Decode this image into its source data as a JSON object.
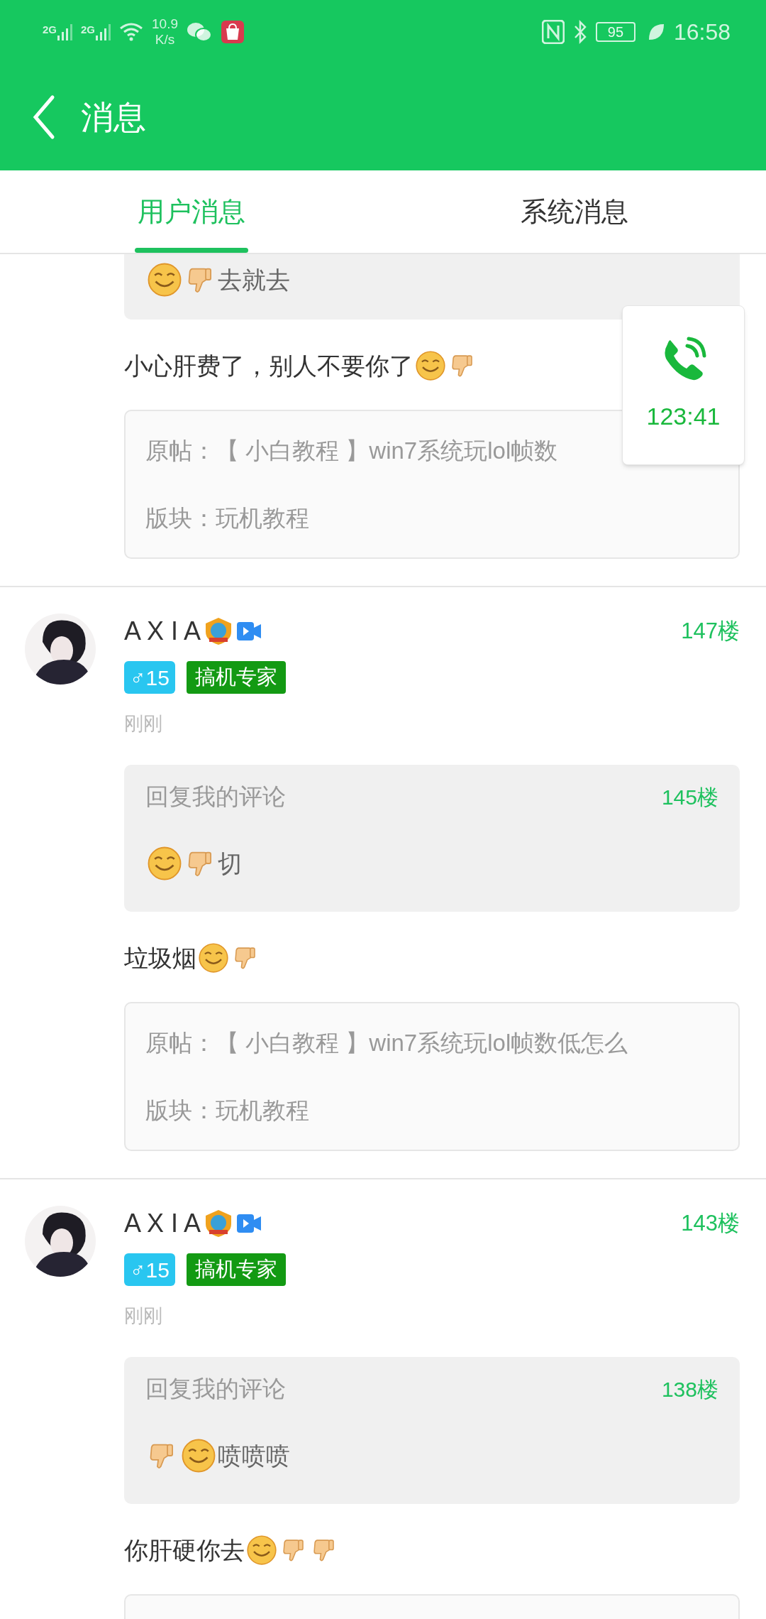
{
  "status_bar": {
    "networks": [
      "2G",
      "2G"
    ],
    "speed": "10.9",
    "speed_unit": "K/s",
    "battery": "95",
    "time": "16:58"
  },
  "header": {
    "title": "消息"
  },
  "tabs": [
    {
      "label": "用户消息",
      "selected": true
    },
    {
      "label": "系统消息",
      "selected": false
    }
  ],
  "messages": [
    {
      "reply": {
        "content": [
          {
            "kind": "smile"
          },
          {
            "kind": "thumbs_down"
          },
          {
            "kind": "text",
            "text": "去就去"
          }
        ]
      },
      "comment": [
        {
          "kind": "text",
          "text": "小心肝费了，别人不要你了"
        },
        {
          "kind": "smile"
        },
        {
          "kind": "thumbs_down"
        }
      ],
      "post": {
        "title": "原帖：【 小白教程 】win7系统玩lol帧数",
        "board": "版块：玩机教程"
      }
    },
    {
      "user": {
        "name": "A X I A",
        "gender": "♂",
        "level": "15",
        "title": "搞机专家"
      },
      "floor": "147楼",
      "time": "刚刚",
      "reply": {
        "label": "回复我的评论",
        "floor": "145楼",
        "content": [
          {
            "kind": "smile"
          },
          {
            "kind": "thumbs_down"
          },
          {
            "kind": "text",
            "text": "切"
          }
        ]
      },
      "comment": [
        {
          "kind": "text",
          "text": "垃圾烟"
        },
        {
          "kind": "smile"
        },
        {
          "kind": "thumbs_down"
        }
      ],
      "post": {
        "title": "原帖：【 小白教程 】win7系统玩lol帧数低怎么",
        "board": "版块：玩机教程"
      }
    },
    {
      "user": {
        "name": "A X I A",
        "gender": "♂",
        "level": "15",
        "title": "搞机专家"
      },
      "floor": "143楼",
      "time": "刚刚",
      "reply": {
        "label": "回复我的评论",
        "floor": "138楼",
        "content": [
          {
            "kind": "thumbs_down"
          },
          {
            "kind": "smile"
          },
          {
            "kind": "text",
            "text": "喷喷喷"
          }
        ]
      },
      "comment": [
        {
          "kind": "text",
          "text": "你肝硬你去"
        },
        {
          "kind": "smile"
        },
        {
          "kind": "thumbs_down"
        },
        {
          "kind": "thumbs_down"
        }
      ],
      "post": {
        "kind": "empty"
      }
    }
  ],
  "call_widget": {
    "duration": "123:41"
  }
}
